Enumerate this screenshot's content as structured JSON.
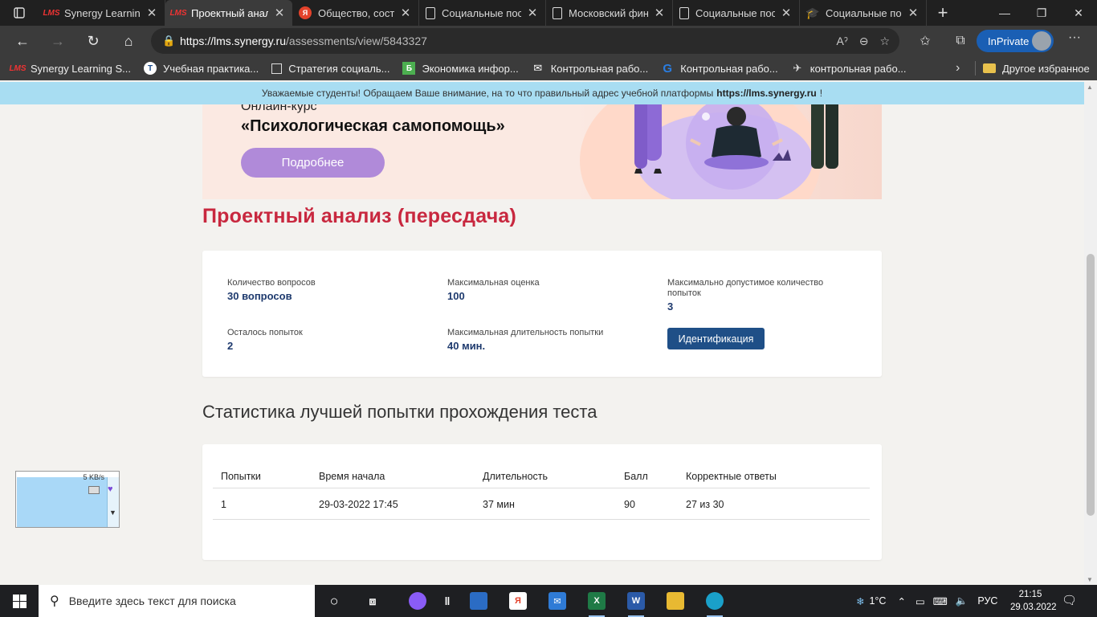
{
  "browser": {
    "tabs": [
      {
        "title": "Synergy Learning",
        "icon": "lms-logo",
        "active": false
      },
      {
        "title": "Проектный анал",
        "icon": "lms-logo",
        "active": true
      },
      {
        "title": "Общество, сост",
        "icon": "yandex-icon",
        "active": false
      },
      {
        "title": "Социальные пос",
        "icon": "document-icon",
        "active": false
      },
      {
        "title": "Московский фин",
        "icon": "document-icon",
        "active": false
      },
      {
        "title": "Социальные пос",
        "icon": "document-icon",
        "active": false
      },
      {
        "title": "Социальные пос",
        "icon": "graduation-cap-icon",
        "active": false
      }
    ],
    "url_host": "https://lms.synergy.ru",
    "url_path": "/assessments/view/5843327",
    "inprivate_label": "InPrivate",
    "favorites": [
      {
        "label": "Synergy Learning S...",
        "icon": "lms-logo"
      },
      {
        "label": "Учебная практика...",
        "icon": "round-logo"
      },
      {
        "label": "Стратегия социаль...",
        "icon": "page-icon"
      },
      {
        "label": "Экономика инфор...",
        "icon": "b-icon"
      },
      {
        "label": "Контрольная рабо...",
        "icon": "envelope-icon"
      },
      {
        "label": "Контрольная рабо...",
        "icon": "g-icon"
      },
      {
        "label": "контрольная рабо...",
        "icon": "bird-icon"
      }
    ],
    "other_favorites": "Другое избранное"
  },
  "notice": {
    "text": "Уважаемые студенты! Обращаем Ваше внимание, на то что правильный адрес учебной платформы",
    "link": "https://lms.synergy.ru",
    "tail": "!"
  },
  "banner": {
    "kicker": "Онлайн-курс",
    "course": "«Психологическая самопомощь»",
    "button": "Подробнее"
  },
  "page": {
    "title": "Проектный анализ (пересдача)"
  },
  "info": {
    "questions_label": "Количество вопросов",
    "questions_value": "30 вопросов",
    "max_score_label": "Максимальная оценка",
    "max_score_value": "100",
    "max_attempts_label": "Максимально допустимое количество попыток",
    "max_attempts_value": "3",
    "attempts_left_label": "Осталось попыток",
    "attempts_left_value": "2",
    "max_duration_label": "Максимальная длительность попытки",
    "max_duration_value": "40 мин.",
    "ident_button": "Идентификация"
  },
  "stats": {
    "title": "Статистика лучшей попытки прохождения теста",
    "columns": [
      "Попытки",
      "Время начала",
      "Длительность",
      "Балл",
      "Корректные ответы"
    ],
    "rows": [
      [
        "1",
        "29-03-2022 17:45",
        "37 мин",
        "90",
        "27 из 30"
      ]
    ]
  },
  "net_widget": {
    "speed": "5 KB/s"
  },
  "taskbar": {
    "search_placeholder": "Введите здесь текст для поиска",
    "weather": "1°C",
    "lang": "РУС",
    "time": "21:15",
    "date": "29.03.2022"
  },
  "colors": {
    "title_red": "#c8283f",
    "value_blue": "#1e3a6e",
    "button_blue": "#1f4f87",
    "banner_button": "#b08ad9",
    "notice_bg": "#a8ddf2"
  }
}
